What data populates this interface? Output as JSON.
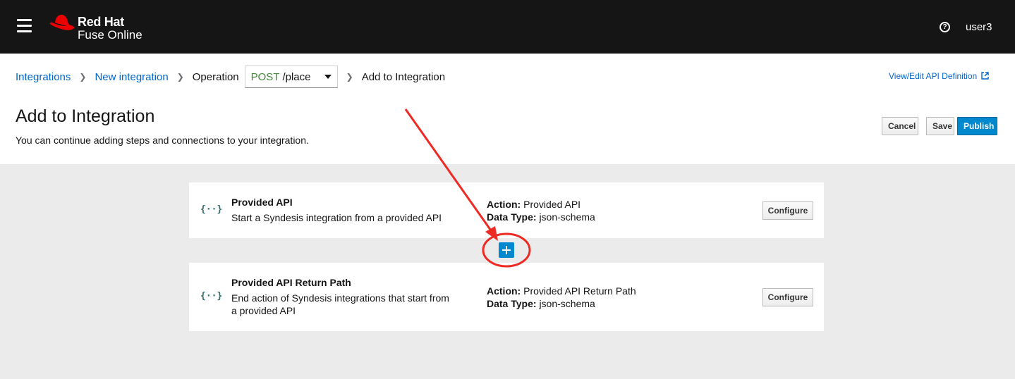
{
  "brand": {
    "line1": "Red Hat",
    "line2": "Fuse Online",
    "logo_color": "#ee0000"
  },
  "masthead": {
    "username": "user3",
    "help_icon": "question-circle-icon"
  },
  "breadcrumb": {
    "items": [
      "Integrations",
      "New integration"
    ],
    "operation_label": "Operation",
    "operation_method": "POST",
    "operation_path": "/place",
    "current": "Add to Integration"
  },
  "api_definition_link": "View/Edit API Definition",
  "page": {
    "title": "Add to Integration",
    "description": "You can continue adding steps and connections to your integration."
  },
  "actions": {
    "cancel": "Cancel",
    "save": "Save",
    "publish": "Publish"
  },
  "steps": [
    {
      "icon": "{··}",
      "name": "Provided API",
      "description": "Start a Syndesis integration from a provided API",
      "action_label": "Action:",
      "action_value": "Provided API",
      "datatype_label": "Data Type:",
      "datatype_value": "json-schema",
      "configure": "Configure"
    },
    {
      "icon": "{··}",
      "name": "Provided API Return Path",
      "description": "End action of Syndesis integrations that start from a provided API",
      "action_label": "Action:",
      "action_value": "Provided API Return Path",
      "datatype_label": "Data Type:",
      "datatype_value": "json-schema",
      "configure": "Configure"
    }
  ],
  "colors": {
    "masthead": "#151515",
    "link": "#0066cc",
    "primary": "#0088ce",
    "method_post": "#3e8635",
    "annotation": "#ee2a24"
  }
}
